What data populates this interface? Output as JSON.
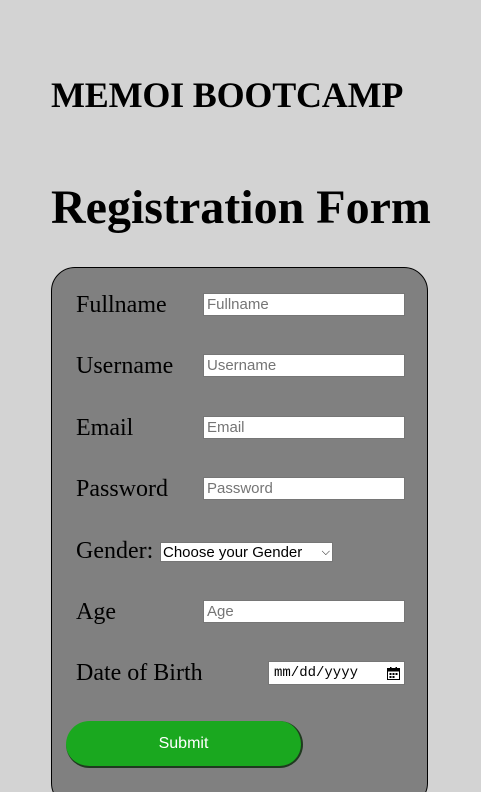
{
  "header": {
    "brand": "MEMOI BOOTCAMP",
    "title": "Registration Form"
  },
  "form": {
    "fields": {
      "fullname": {
        "label": "Fullname",
        "placeholder": "Fullname"
      },
      "username": {
        "label": "Username",
        "placeholder": "Username"
      },
      "email": {
        "label": "Email",
        "placeholder": "Email"
      },
      "password": {
        "label": "Password",
        "placeholder": "Password"
      },
      "gender": {
        "label": "Gender:",
        "selected": "Choose your Gender"
      },
      "age": {
        "label": "Age",
        "placeholder": "Age"
      },
      "dob": {
        "label": "Date of Birth",
        "placeholder": "mm/dd/yyyy"
      }
    },
    "submit_label": "Submit"
  },
  "colors": {
    "page_background": "#d3d3d3",
    "form_background": "#808080",
    "submit_button": "#1aa81f"
  },
  "icons": {
    "gender_dropdown": "chevron-down-icon",
    "dob_picker": "calendar-icon"
  }
}
